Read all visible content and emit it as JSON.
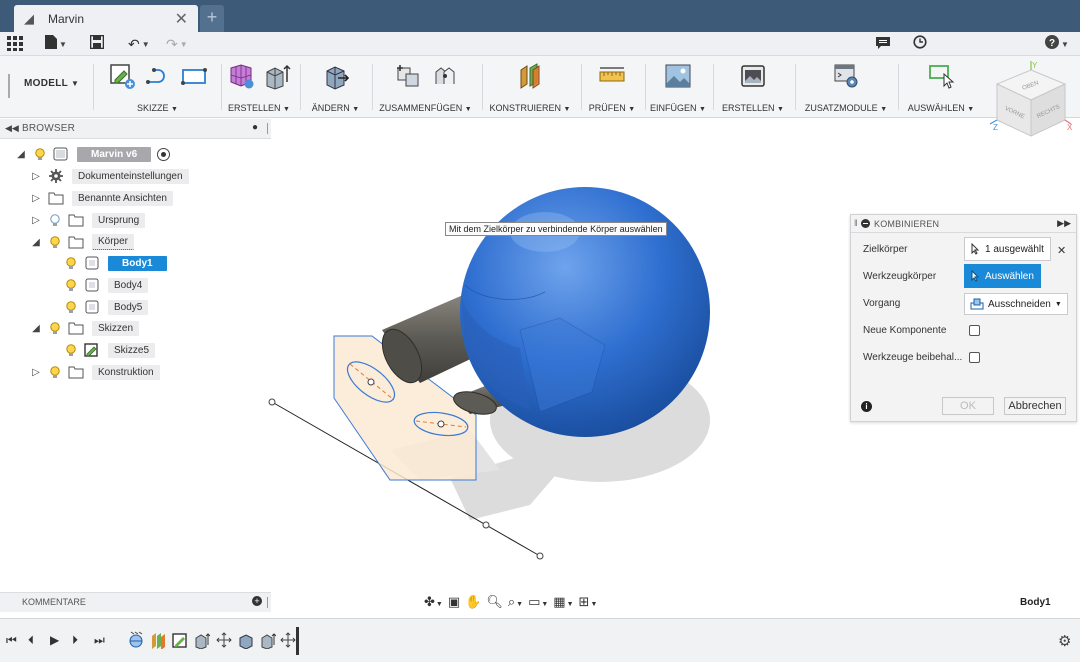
{
  "app": {
    "tab_title": "Marvin",
    "tab_icon": "box-icon",
    "new_tab_label": "+"
  },
  "toolbar": {
    "workspace": "MODELL",
    "groups": [
      {
        "key": "skizze",
        "label": "SKIZZE"
      },
      {
        "key": "erstellen",
        "label": "ERSTELLEN"
      },
      {
        "key": "aendern",
        "label": "ÄNDERN"
      },
      {
        "key": "zusammenfuegen",
        "label": "ZUSAMMENFÜGEN"
      },
      {
        "key": "konstruieren",
        "label": "KONSTRUIEREN"
      },
      {
        "key": "pruefen",
        "label": "PRÜFEN"
      },
      {
        "key": "einfuegen",
        "label": "EINFÜGEN"
      },
      {
        "key": "erstellen2",
        "label": "ERSTELLEN"
      },
      {
        "key": "zusatzmodule",
        "label": "ZUSATZMODULE"
      },
      {
        "key": "auswaehlen",
        "label": "AUSWÄHLEN"
      }
    ]
  },
  "viewcube": {
    "top": "OBEN",
    "front": "VORNE",
    "right": "RECHTS",
    "axis_x": "X",
    "axis_y": "Y",
    "axis_z": "Z"
  },
  "browser": {
    "title": "BROWSER",
    "root": "Marvin v6",
    "nodes": [
      {
        "label": "Dokumenteinstellungen"
      },
      {
        "label": "Benannte Ansichten"
      },
      {
        "label": "Ursprung"
      },
      {
        "label": "Körper"
      },
      {
        "label": "Body1"
      },
      {
        "label": "Body4"
      },
      {
        "label": "Body5"
      },
      {
        "label": "Skizzen"
      },
      {
        "label": "Skizze5"
      },
      {
        "label": "Konstruktion"
      }
    ]
  },
  "tooltip": "Mit dem Zielkörper zu verbindende Körper auswählen",
  "combine": {
    "title": "KOMBINIEREN",
    "rows": {
      "target_label": "Zielkörper",
      "target_value": "1 ausgewählt",
      "tool_label": "Werkzeugkörper",
      "tool_value": "Auswählen",
      "operation_label": "Vorgang",
      "operation_value": "Ausschneiden",
      "new_component_label": "Neue Komponente",
      "keep_tools_label": "Werkzeuge beibehal..."
    },
    "ok": "OK",
    "cancel": "Abbrechen"
  },
  "comments": {
    "title": "KOMMENTARE"
  },
  "status": {
    "selection": "Body1"
  },
  "colors": {
    "title_bar": "#3e5a79",
    "accent": "#1a8ad8",
    "body_blue": "#2f6fd0",
    "cylinder": "#6b6a64",
    "sketch_fill": "#fbe9d3"
  }
}
